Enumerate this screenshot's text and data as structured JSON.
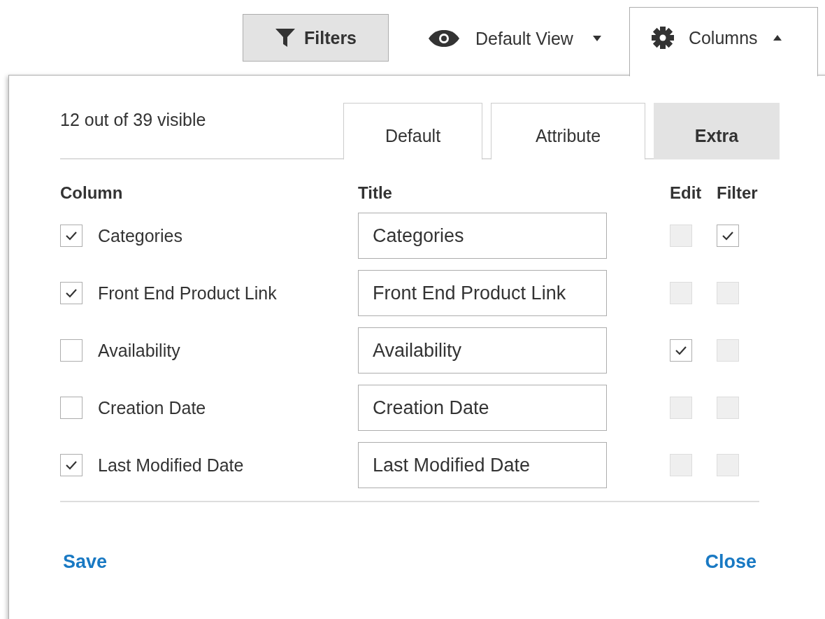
{
  "toolbar": {
    "filters": "Filters",
    "view": "Default View",
    "columns": "Columns",
    "columns_expanded": true
  },
  "panel": {
    "summary": "12 out of 39 visible",
    "tabs": [
      {
        "label": "Default",
        "selected": false
      },
      {
        "label": "Attribute",
        "selected": false
      },
      {
        "label": "Extra",
        "selected": true
      }
    ],
    "headers": {
      "column": "Column",
      "title": "Title",
      "edit": "Edit",
      "filter": "Filter"
    },
    "rows": [
      {
        "name": "Categories",
        "checked": true,
        "title": "Categories",
        "edit": {
          "checked": false,
          "disabled": true
        },
        "filter": {
          "checked": true,
          "disabled": false
        }
      },
      {
        "name": "Front End Product Link",
        "checked": true,
        "title": "Front End Product Link",
        "edit": {
          "checked": false,
          "disabled": true
        },
        "filter": {
          "checked": false,
          "disabled": true
        }
      },
      {
        "name": "Availability",
        "checked": false,
        "title": "Availability",
        "edit": {
          "checked": true,
          "disabled": false
        },
        "filter": {
          "checked": false,
          "disabled": true
        }
      },
      {
        "name": "Creation Date",
        "checked": false,
        "title": "Creation Date",
        "edit": {
          "checked": false,
          "disabled": true
        },
        "filter": {
          "checked": false,
          "disabled": true
        }
      },
      {
        "name": "Last Modified Date",
        "checked": true,
        "title": "Last Modified Date",
        "edit": {
          "checked": false,
          "disabled": true
        },
        "filter": {
          "checked": false,
          "disabled": true
        }
      }
    ],
    "save": "Save",
    "close": "Close"
  }
}
